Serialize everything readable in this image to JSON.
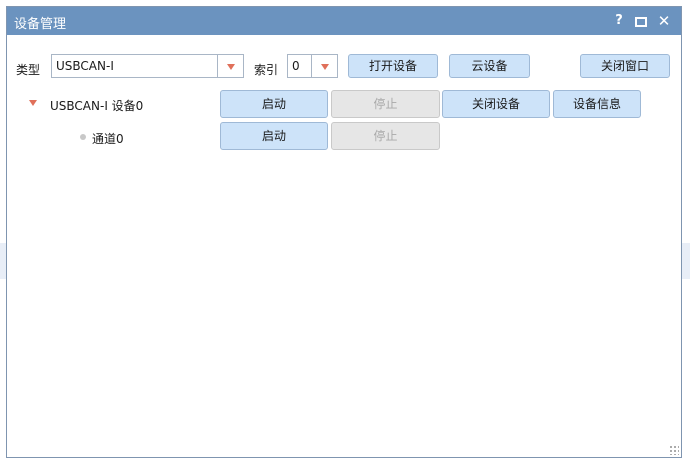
{
  "window": {
    "title": "设备管理",
    "help_glyph": "?",
    "close_glyph": "✕"
  },
  "toolbar": {
    "type_label": "类型",
    "type_value": "USBCAN-I",
    "index_label": "索引",
    "index_value": "0",
    "open_device": "打开设备",
    "cloud_device": "云设备",
    "close_window": "关闭窗口"
  },
  "tree": {
    "device": {
      "label": "USBCAN-I 设备0",
      "start": "启动",
      "stop": "停止",
      "close_device": "关闭设备",
      "device_info": "设备信息"
    },
    "channel": {
      "label": "通道0",
      "start": "启动",
      "stop": "停止"
    }
  },
  "colors": {
    "titlebar": "#6b93bf",
    "button_bg": "#cde3f9",
    "button_disabled_bg": "#e6e6e6",
    "dropdown_arrow": "#e0705a"
  }
}
